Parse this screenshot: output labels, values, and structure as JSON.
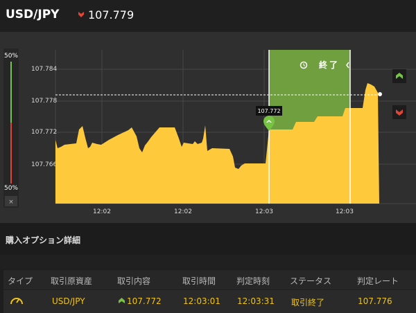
{
  "header": {
    "pair": "USD/JPY",
    "current_price": "107.779",
    "direction_icon": "down-arrow-icon"
  },
  "chart": {
    "left_bar": {
      "top_pct": "50%",
      "bottom_pct": "50%",
      "close_symbol": "×"
    },
    "y_ticks": [
      "107.784",
      "107.778",
      "107.772",
      "107.766"
    ],
    "x_ticks": [
      "12:02",
      "12:02",
      "12:03",
      "12:03"
    ],
    "marker_label": "107.772",
    "end_label": "終了",
    "buttons": {
      "high_icon": "up-arrow-icon",
      "low_icon": "down-arrow-icon"
    },
    "colors": {
      "area": "#ffc93c",
      "zone": "#6f9f3e",
      "up": "#76c442",
      "down": "#e0453a"
    }
  },
  "details": {
    "title": "購入オプション詳細",
    "columns": [
      "タイプ",
      "取引原資産",
      "取引内容",
      "取引時間",
      "判定時刻",
      "ステータス",
      "判定レート"
    ],
    "row": {
      "type_icon": "gauge-icon",
      "asset": "USD/JPY",
      "direction_icon": "up-arrow-icon",
      "entry_rate": "107.772",
      "trade_time": "12:03:01",
      "expiry_time": "12:03:31",
      "status": "取引終了",
      "result_rate": "107.776"
    }
  }
}
